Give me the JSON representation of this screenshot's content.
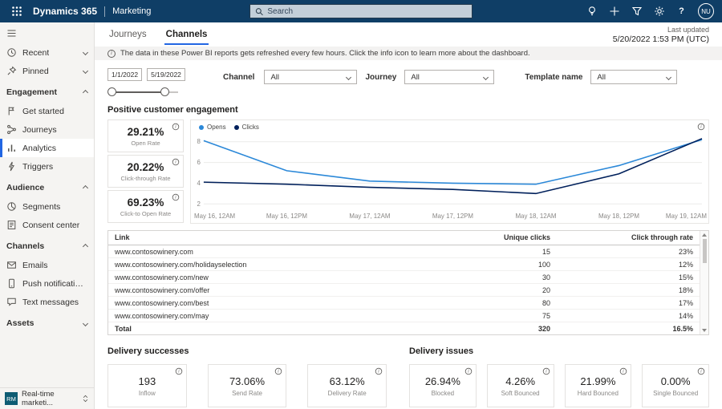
{
  "topbar": {
    "brand": "Dynamics 365",
    "app": "Marketing",
    "search_placeholder": "Search",
    "avatar_initials": "NU"
  },
  "icons": {
    "topbar": [
      "app-launcher",
      "search",
      "lightbulb",
      "add",
      "filter",
      "settings",
      "help"
    ],
    "sidebar": [
      "hamburger",
      "clock",
      "pin",
      "flag",
      "journey",
      "bar-chart",
      "lightning",
      "pie",
      "list",
      "envelope",
      "phone",
      "chat"
    ]
  },
  "colors": {
    "topbar": "#0f3e66",
    "accent": "#2266e3",
    "opens_line": "#2b88d8",
    "clicks_line": "#00205b"
  },
  "sidebar": {
    "recent": "Recent",
    "pinned": "Pinned",
    "sections": {
      "engagement": {
        "label": "Engagement",
        "items": {
          "get_started": "Get started",
          "journeys": "Journeys",
          "analytics": "Analytics",
          "triggers": "Triggers"
        }
      },
      "audience": {
        "label": "Audience",
        "items": {
          "segments": "Segments",
          "consent": "Consent center"
        }
      },
      "channels": {
        "label": "Channels",
        "items": {
          "emails": "Emails",
          "push": "Push notifications",
          "sms": "Text messages"
        }
      },
      "assets": {
        "label": "Assets"
      }
    },
    "area_badge": "RM",
    "area_switcher": "Real-time marketi..."
  },
  "header": {
    "tabs": {
      "journeys": "Journeys",
      "channels": "Channels"
    },
    "last_updated_label": "Last updated",
    "last_updated_value": "5/20/2022 1:53 PM (UTC)",
    "banner": "The data in these Power BI reports gets refreshed every few hours. Click the info icon to learn more about the dashboard."
  },
  "filters": {
    "date_start": "1/1/2022",
    "date_end": "5/19/2022",
    "channel_label": "Channel",
    "channel_value": "All",
    "journey_label": "Journey",
    "journey_value": "All",
    "template_label": "Template name",
    "template_value": "All"
  },
  "engagement": {
    "title": "Positive customer engagement",
    "kpis": [
      {
        "value": "29.21%",
        "label": "Open Rate"
      },
      {
        "value": "20.22%",
        "label": "Click-through Rate"
      },
      {
        "value": "69.23%",
        "label": "Click-to Open Rate"
      }
    ]
  },
  "chart_data": {
    "type": "line",
    "x": [
      "May 16, 12AM",
      "May 16, 12PM",
      "May 17, 12AM",
      "May 17, 12PM",
      "May 18, 12AM",
      "May 18, 12PM",
      "May 19, 12AM"
    ],
    "series": [
      {
        "name": "Opens",
        "color": "#2b88d8",
        "values": [
          8.1,
          5.2,
          4.2,
          4.0,
          3.9,
          5.7,
          8.2
        ]
      },
      {
        "name": "Clicks",
        "color": "#00205b",
        "values": [
          4.1,
          3.9,
          3.6,
          3.4,
          3.0,
          4.9,
          8.3
        ]
      }
    ],
    "yticks": [
      2,
      4,
      6,
      8
    ],
    "ylim": [
      2,
      8.6
    ],
    "legend_position": "top-left",
    "grid": true
  },
  "links_table": {
    "columns": [
      "Link",
      "Unique clicks",
      "Click through rate"
    ],
    "rows": [
      [
        "www.contosowinery.com",
        "15",
        "23%"
      ],
      [
        "www.contosowinery.com/holidayselection",
        "100",
        "12%"
      ],
      [
        "www.contosowinery.com/new",
        "30",
        "15%"
      ],
      [
        "www.contosowinery.com/offer",
        "20",
        "18%"
      ],
      [
        "www.contosowinery.com/best",
        "80",
        "17%"
      ],
      [
        "www.contosowinery.com/may",
        "75",
        "14%"
      ]
    ],
    "total": [
      "Total",
      "320",
      "16.5%"
    ]
  },
  "delivery": {
    "successes_title": "Delivery successes",
    "issues_title": "Delivery issues",
    "successes": [
      {
        "value": "193",
        "label": "Inflow"
      },
      {
        "value": "73.06%",
        "label": "Send Rate"
      },
      {
        "value": "63.12%",
        "label": "Delivery Rate"
      }
    ],
    "issues": [
      {
        "value": "26.94%",
        "label": "Blocked"
      },
      {
        "value": "4.26%",
        "label": "Soft Bounced"
      },
      {
        "value": "21.99%",
        "label": "Hard Bounced"
      },
      {
        "value": "0.00%",
        "label": "Single Bounced"
      }
    ]
  }
}
